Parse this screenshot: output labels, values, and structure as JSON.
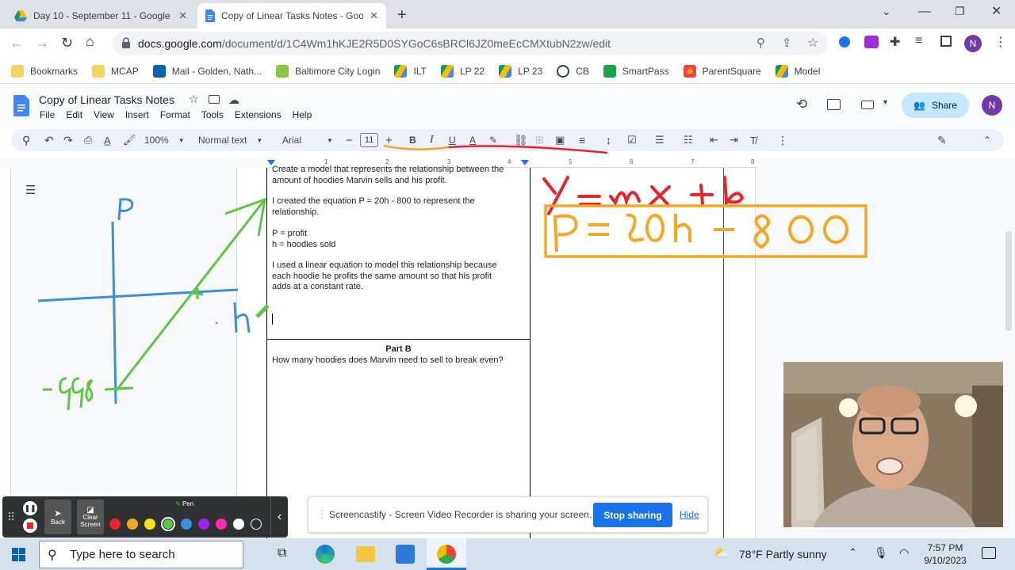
{
  "browser": {
    "tabs": [
      {
        "title": "Day 10 - September 11 - Google",
        "active": false
      },
      {
        "title": "Copy of Linear Tasks Notes - Goo",
        "active": true
      }
    ],
    "url_domain": "docs.google.com",
    "url_path": "/document/d/1C4Wm1hKJE2R5D0SYGoC6sBRCl6JZ0meEcCMXtubN2zw/edit",
    "profile_initial": "N",
    "bookmarks": [
      {
        "label": "Bookmarks",
        "icon": "folder-icon"
      },
      {
        "label": "MCAP",
        "icon": "folder-icon"
      },
      {
        "label": "Mail - Golden, Nath...",
        "icon": "outlook-icon"
      },
      {
        "label": "Baltimore City Login",
        "icon": "clever-icon"
      },
      {
        "label": "ILT",
        "icon": "drive-icon"
      },
      {
        "label": "LP 22",
        "icon": "drive-icon"
      },
      {
        "label": "LP 23",
        "icon": "drive-icon"
      },
      {
        "label": "CB",
        "icon": "shield-icon"
      },
      {
        "label": "SmartPass",
        "icon": "smartpass-icon"
      },
      {
        "label": "ParentSquare",
        "icon": "parentsquare-icon"
      },
      {
        "label": "Model",
        "icon": "drive-icon"
      }
    ]
  },
  "docs": {
    "title": "Copy of Linear Tasks Notes",
    "menu": [
      "File",
      "Edit",
      "View",
      "Insert",
      "Format",
      "Tools",
      "Extensions",
      "Help"
    ],
    "share_label": "Share",
    "user_initial": "N",
    "toolbar": {
      "zoom": "100%",
      "style": "Normal text",
      "font": "Arial",
      "font_size": "11"
    },
    "ruler_numbers": [
      "1",
      "2",
      "3",
      "4",
      "5",
      "6",
      "7",
      "8"
    ]
  },
  "document": {
    "partA_lines": [
      "Create a model that represents the relationship between the",
      "amount of hoodies Marvin sells and his profit."
    ],
    "equation_lines": [
      "I created the equation P = 20h - 800 to represent the",
      "relationship."
    ],
    "variables": [
      "P = profit",
      "h = hoodies sold"
    ],
    "reason_lines": [
      "I used a linear equation to model this relationship because",
      "each hoodie he profits the same amount so that his profit",
      "adds at a constant rate."
    ],
    "partB_title": "Part B",
    "partB_question": "How many hoodies does Marvin need to sell to break even?"
  },
  "handwriting": {
    "slope_form": "y = mx + b",
    "equation": "P = 20h - 800",
    "axis_y": "P",
    "axis_x": "h",
    "intercept": "-800",
    "colors": {
      "red": "#e8242a",
      "orange": "#f5a623",
      "blue": "#3b8fe0",
      "green": "#5cc641"
    }
  },
  "annotation_toolbar": {
    "tool_label": "Pen",
    "back_label": "Back",
    "clear_label": "Clear Screen",
    "colors": [
      "#e8242a",
      "#f5a623",
      "#f7e11b",
      "#5cc641",
      "#3b8fe0",
      "#a020f0",
      "#ff2aa8",
      "#ffffff",
      "#2f3133"
    ]
  },
  "share_banner": {
    "message": "Screencastify - Screen Video Recorder is sharing your screen.",
    "stop_label": "Stop sharing",
    "hide_label": "Hide"
  },
  "taskbar": {
    "search_placeholder": "Type here to search",
    "weather": "78°F  Partly sunny",
    "time": "7:57 PM",
    "date": "9/10/2023"
  }
}
